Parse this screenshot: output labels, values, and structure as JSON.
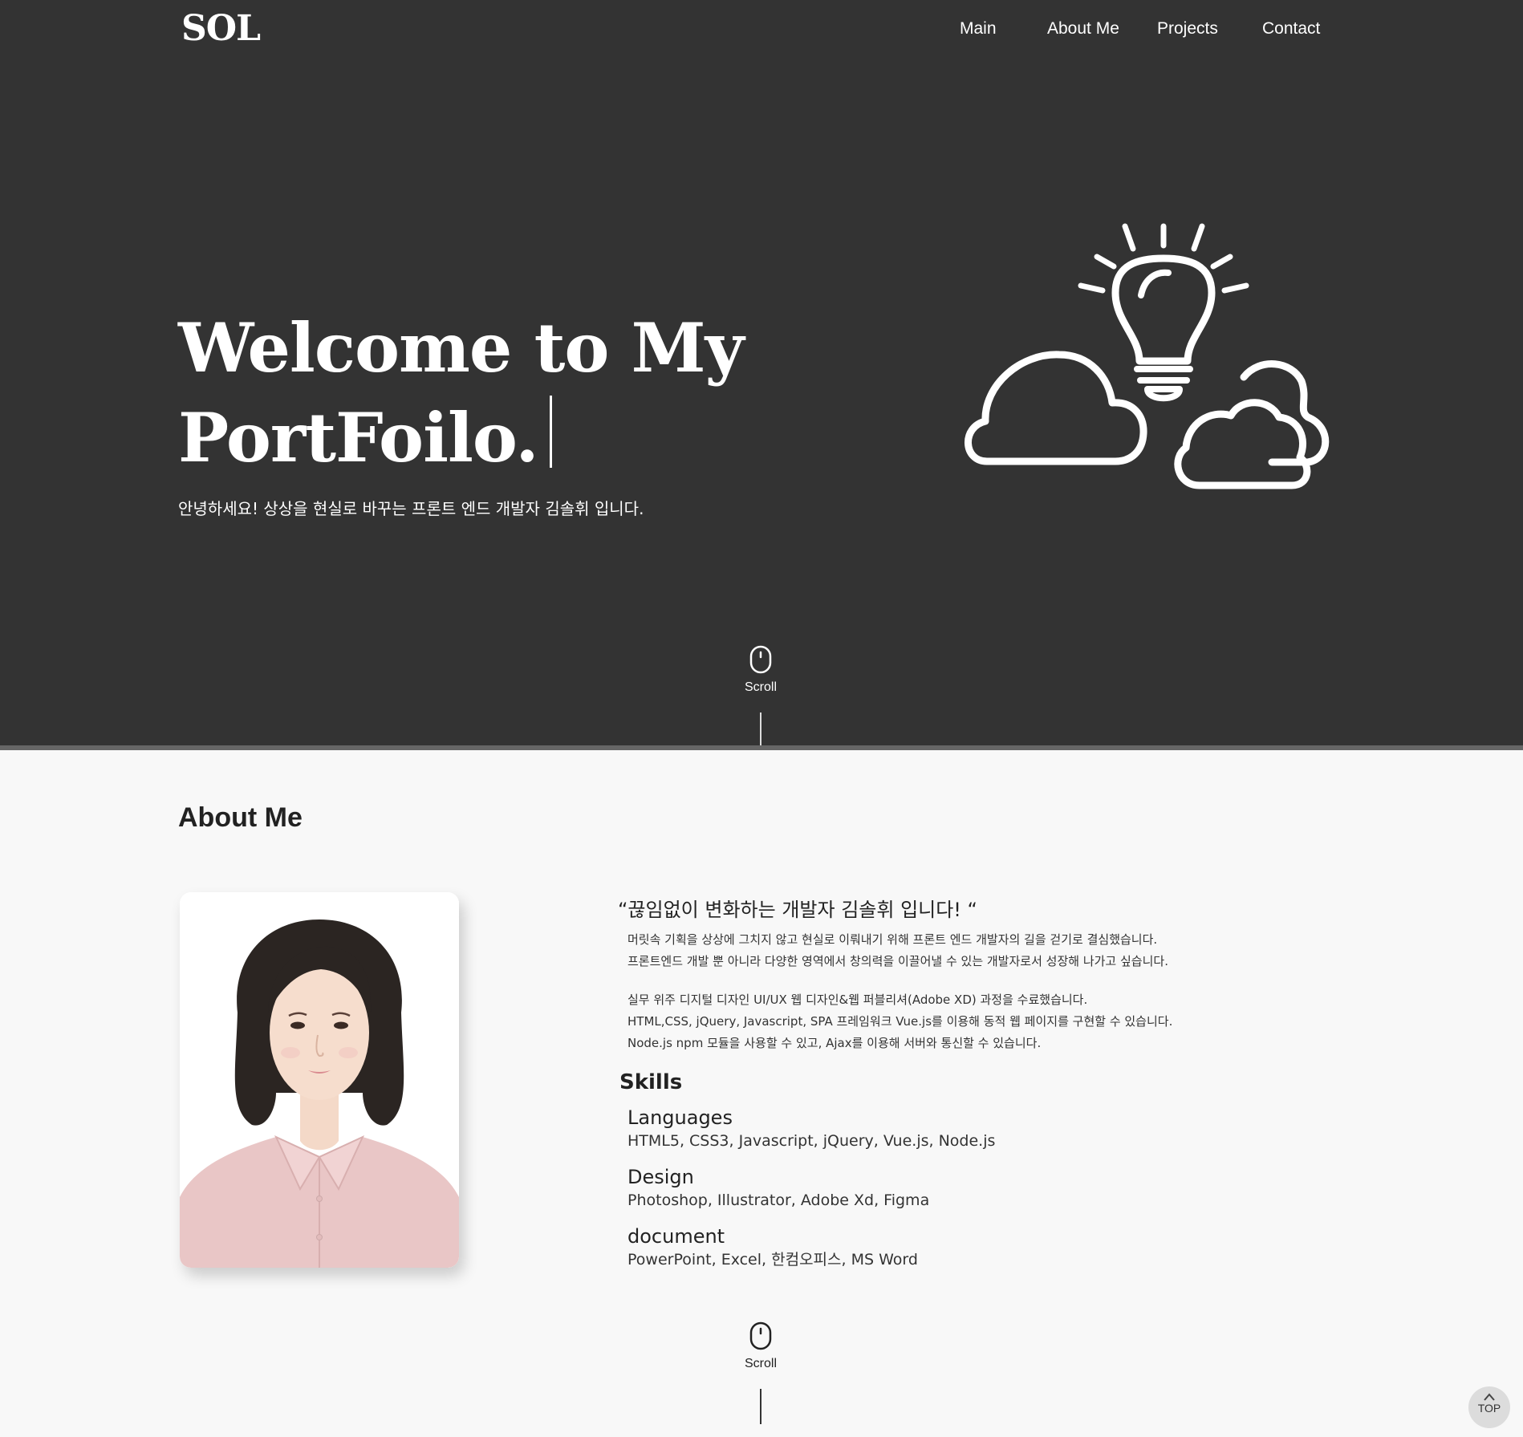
{
  "header": {
    "logo": "SOL",
    "nav": [
      {
        "label": "Main"
      },
      {
        "label": "About Me"
      },
      {
        "label": "Projects"
      },
      {
        "label": "Contact"
      }
    ]
  },
  "hero": {
    "title_line1": "Welcome to My",
    "title_line2": "PortFoilo.",
    "subtitle": "안녕하세요! 상상을 현실로 바꾸는 프론트 엔드 개발자 김솔휘 입니다.",
    "scroll_label": "Scroll",
    "illustration_icon": "lightbulb-clouds-icon"
  },
  "about": {
    "heading": "About Me",
    "quote": "“끊임없이 변화하는 개발자 김솔휘 입니다! “",
    "paragraph1": [
      "머릿속 기획을 상상에 그치지 않고 현실로 이뤄내기 위해 프론트 엔드 개발자의 길을 걷기로 결심했습니다.",
      "프론트엔드 개발 뿐 아니라 다양한 영역에서 창의력을 이끌어낼 수 있는 개발자로서 성장해 나가고 싶습니다."
    ],
    "paragraph2": [
      "실무 위주 디지털 디자인 UI/UX 웹 디자인&웹 퍼블리셔(Adobe XD) 과정을 수료했습니다.",
      "HTML,CSS, jQuery, Javascript, SPA 프레임워크 Vue.js를 이용해 동적 웹 페이지를 구현할 수 있습니다.",
      "Node.js npm 모듈을 사용할 수 있고, Ajax를 이용해 서버와 통신할 수 있습니다."
    ],
    "skills_title": "Skills",
    "skills": [
      {
        "title": "Languages",
        "items": "HTML5, CSS3, Javascript, jQuery, Vue.js, Node.js"
      },
      {
        "title": "Design",
        "items": "Photoshop, Illustrator, Adobe Xd, Figma"
      },
      {
        "title": "document",
        "items": "PowerPoint, Excel, 한컴오피스, MS Word"
      }
    ],
    "scroll_label": "Scroll"
  },
  "top_button": {
    "label": "TOP"
  },
  "colors": {
    "hero_bg": "#333333",
    "about_bg": "#f8f8f8",
    "text_dark": "#222222",
    "shirt_pink": "#e9c6c6"
  }
}
